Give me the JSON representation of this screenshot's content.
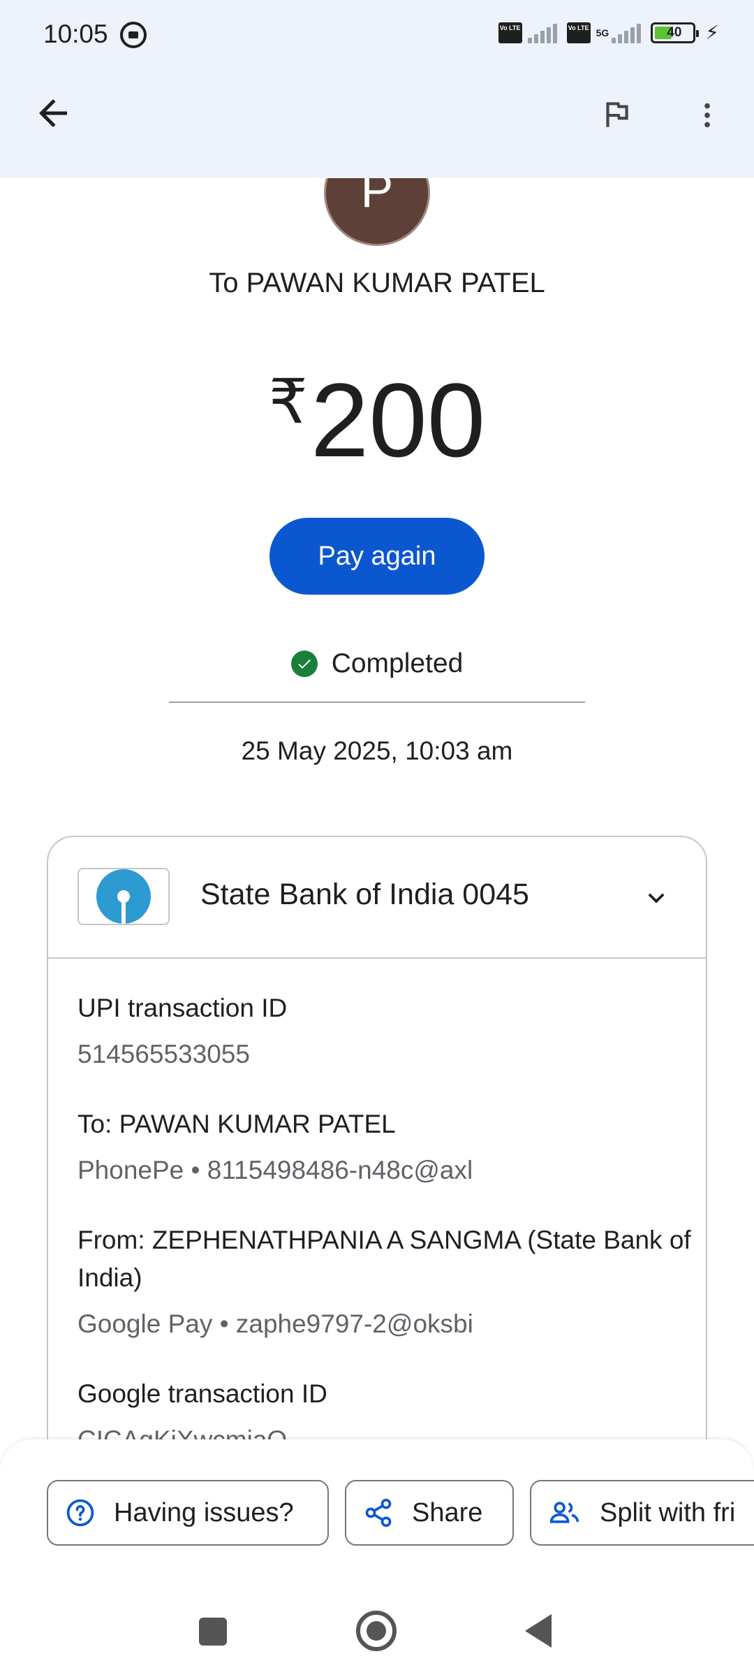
{
  "status_bar": {
    "time": "10:05",
    "volte_1": "Vo LTE",
    "volte_2": "Vo LTE",
    "network": "5G",
    "battery": "40"
  },
  "app_bar": {
    "icons": [
      "back-arrow-icon",
      "flag-icon",
      "more-vert-icon"
    ]
  },
  "header": {
    "avatar_initial": "P",
    "to_name": "To PAWAN KUMAR PATEL",
    "currency": "₹",
    "amount": "200",
    "pay_again_label": "Pay again",
    "status": "Completed",
    "datetime": "25 May 2025, 10:03 am"
  },
  "card": {
    "bank_name": "State Bank of India 0045",
    "details": [
      {
        "label": "UPI transaction ID",
        "value": "514565533055"
      },
      {
        "label": "To: PAWAN KUMAR PATEL",
        "value": "PhonePe • 8115498486-n48c@axl"
      },
      {
        "label": "From: ZEPHENATHPANIA A SANGMA (State Bank of India)",
        "value": "Google Pay • zaphe9797-2@oksbi"
      },
      {
        "label": "Google transaction ID",
        "value": "CICAgKiXwcmiaQ"
      }
    ]
  },
  "actions": {
    "issues": "Having issues?",
    "share": "Share",
    "split": "Split with fri"
  },
  "colors": {
    "primary": "#0b57d0",
    "success": "#188038",
    "appbar_bg": "#eef2fb",
    "avatar_bg": "#5d4037",
    "bank_logo": "#2d9ad1"
  }
}
